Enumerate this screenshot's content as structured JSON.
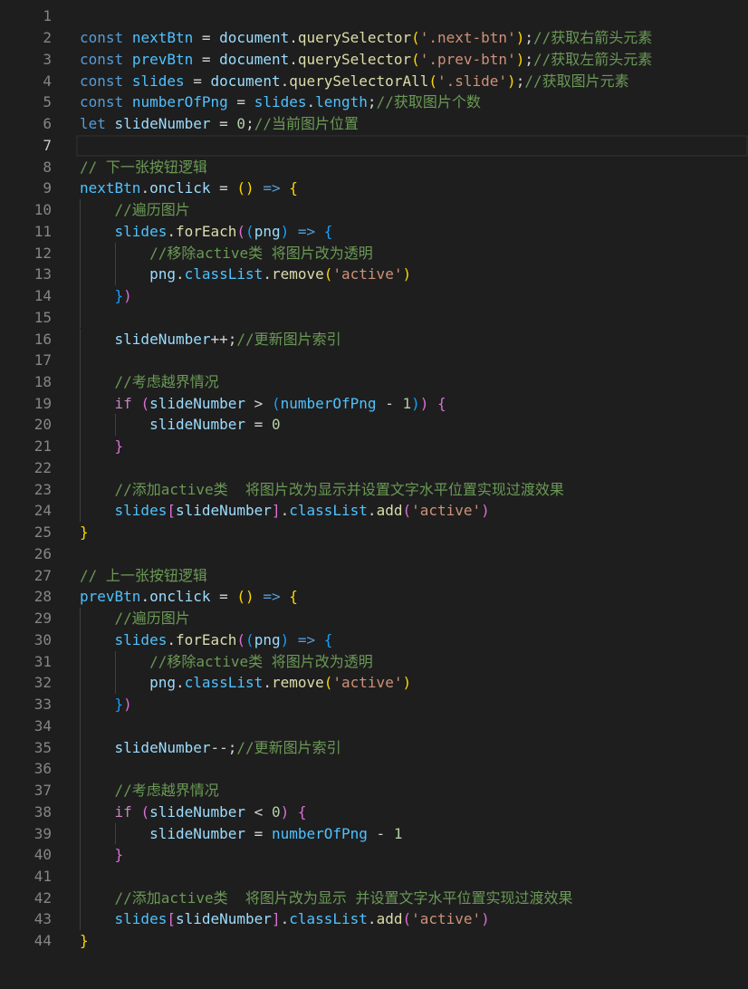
{
  "editor": {
    "active_line": 7,
    "colors": {
      "background": "#1e1e1e",
      "line_number": "#858585",
      "line_number_active": "#c6c6c6",
      "indent_guide": "#404040"
    },
    "lines": [
      {
        "n": "1",
        "tokens": []
      },
      {
        "n": "2",
        "tokens": [
          {
            "t": "const",
            "c": "#569cd6"
          },
          {
            "t": " ",
            "c": "#d4d4d4"
          },
          {
            "t": "nextBtn",
            "c": "#4fc1ff"
          },
          {
            "t": " = ",
            "c": "#d4d4d4"
          },
          {
            "t": "document",
            "c": "#9cdcfe"
          },
          {
            "t": ".",
            "c": "#d4d4d4"
          },
          {
            "t": "querySelector",
            "c": "#dcdcaa"
          },
          {
            "t": "(",
            "c": "#ffd700"
          },
          {
            "t": "'.next-btn'",
            "c": "#ce9178"
          },
          {
            "t": ")",
            "c": "#ffd700"
          },
          {
            "t": ";",
            "c": "#d4d4d4"
          },
          {
            "t": "//获取右箭头元素",
            "c": "#6a9955"
          }
        ]
      },
      {
        "n": "3",
        "tokens": [
          {
            "t": "const",
            "c": "#569cd6"
          },
          {
            "t": " ",
            "c": "#d4d4d4"
          },
          {
            "t": "prevBtn",
            "c": "#4fc1ff"
          },
          {
            "t": " = ",
            "c": "#d4d4d4"
          },
          {
            "t": "document",
            "c": "#9cdcfe"
          },
          {
            "t": ".",
            "c": "#d4d4d4"
          },
          {
            "t": "querySelector",
            "c": "#dcdcaa"
          },
          {
            "t": "(",
            "c": "#ffd700"
          },
          {
            "t": "'.prev-btn'",
            "c": "#ce9178"
          },
          {
            "t": ")",
            "c": "#ffd700"
          },
          {
            "t": ";",
            "c": "#d4d4d4"
          },
          {
            "t": "//获取左箭头元素",
            "c": "#6a9955"
          }
        ]
      },
      {
        "n": "4",
        "tokens": [
          {
            "t": "const",
            "c": "#569cd6"
          },
          {
            "t": " ",
            "c": "#d4d4d4"
          },
          {
            "t": "slides",
            "c": "#4fc1ff"
          },
          {
            "t": " = ",
            "c": "#d4d4d4"
          },
          {
            "t": "document",
            "c": "#9cdcfe"
          },
          {
            "t": ".",
            "c": "#d4d4d4"
          },
          {
            "t": "querySelectorAll",
            "c": "#dcdcaa"
          },
          {
            "t": "(",
            "c": "#ffd700"
          },
          {
            "t": "'.slide'",
            "c": "#ce9178"
          },
          {
            "t": ")",
            "c": "#ffd700"
          },
          {
            "t": ";",
            "c": "#d4d4d4"
          },
          {
            "t": "//获取图片元素",
            "c": "#6a9955"
          }
        ]
      },
      {
        "n": "5",
        "tokens": [
          {
            "t": "const",
            "c": "#569cd6"
          },
          {
            "t": " ",
            "c": "#d4d4d4"
          },
          {
            "t": "numberOfPng",
            "c": "#4fc1ff"
          },
          {
            "t": " = ",
            "c": "#d4d4d4"
          },
          {
            "t": "slides",
            "c": "#4fc1ff"
          },
          {
            "t": ".",
            "c": "#d4d4d4"
          },
          {
            "t": "length",
            "c": "#4fc1ff"
          },
          {
            "t": ";",
            "c": "#d4d4d4"
          },
          {
            "t": "//获取图片个数",
            "c": "#6a9955"
          }
        ]
      },
      {
        "n": "6",
        "tokens": [
          {
            "t": "let",
            "c": "#569cd6"
          },
          {
            "t": " ",
            "c": "#d4d4d4"
          },
          {
            "t": "slideNumber",
            "c": "#9cdcfe"
          },
          {
            "t": " = ",
            "c": "#d4d4d4"
          },
          {
            "t": "0",
            "c": "#b5cea8"
          },
          {
            "t": ";",
            "c": "#d4d4d4"
          },
          {
            "t": "//当前图片位置",
            "c": "#6a9955"
          }
        ]
      },
      {
        "n": "7",
        "tokens": []
      },
      {
        "n": "8",
        "tokens": [
          {
            "t": "// 下一张按钮逻辑",
            "c": "#6a9955"
          }
        ]
      },
      {
        "n": "9",
        "tokens": [
          {
            "t": "nextBtn",
            "c": "#4fc1ff"
          },
          {
            "t": ".",
            "c": "#d4d4d4"
          },
          {
            "t": "onclick",
            "c": "#9cdcfe"
          },
          {
            "t": " = ",
            "c": "#d4d4d4"
          },
          {
            "t": "()",
            "c": "#ffd700"
          },
          {
            "t": " ",
            "c": "#d4d4d4"
          },
          {
            "t": "=>",
            "c": "#569cd6"
          },
          {
            "t": " ",
            "c": "#d4d4d4"
          },
          {
            "t": "{",
            "c": "#ffd700"
          }
        ]
      },
      {
        "n": "10",
        "tokens": [
          {
            "t": "    ",
            "c": "#d4d4d4"
          },
          {
            "t": "//遍历图片",
            "c": "#6a9955"
          }
        ]
      },
      {
        "n": "11",
        "tokens": [
          {
            "t": "    ",
            "c": "#d4d4d4"
          },
          {
            "t": "slides",
            "c": "#4fc1ff"
          },
          {
            "t": ".",
            "c": "#d4d4d4"
          },
          {
            "t": "forEach",
            "c": "#dcdcaa"
          },
          {
            "t": "(",
            "c": "#da70d6"
          },
          {
            "t": "(",
            "c": "#179fff"
          },
          {
            "t": "png",
            "c": "#9cdcfe"
          },
          {
            "t": ")",
            "c": "#179fff"
          },
          {
            "t": " ",
            "c": "#d4d4d4"
          },
          {
            "t": "=>",
            "c": "#569cd6"
          },
          {
            "t": " ",
            "c": "#d4d4d4"
          },
          {
            "t": "{",
            "c": "#179fff"
          }
        ]
      },
      {
        "n": "12",
        "tokens": [
          {
            "t": "        ",
            "c": "#d4d4d4"
          },
          {
            "t": "//移除active类 将图片改为透明",
            "c": "#6a9955"
          }
        ]
      },
      {
        "n": "13",
        "tokens": [
          {
            "t": "        ",
            "c": "#d4d4d4"
          },
          {
            "t": "png",
            "c": "#9cdcfe"
          },
          {
            "t": ".",
            "c": "#d4d4d4"
          },
          {
            "t": "classList",
            "c": "#4fc1ff"
          },
          {
            "t": ".",
            "c": "#d4d4d4"
          },
          {
            "t": "remove",
            "c": "#dcdcaa"
          },
          {
            "t": "(",
            "c": "#ffd700"
          },
          {
            "t": "'active'",
            "c": "#ce9178"
          },
          {
            "t": ")",
            "c": "#ffd700"
          }
        ]
      },
      {
        "n": "14",
        "tokens": [
          {
            "t": "    ",
            "c": "#d4d4d4"
          },
          {
            "t": "}",
            "c": "#179fff"
          },
          {
            "t": ")",
            "c": "#da70d6"
          }
        ]
      },
      {
        "n": "15",
        "tokens": []
      },
      {
        "n": "16",
        "tokens": [
          {
            "t": "    ",
            "c": "#d4d4d4"
          },
          {
            "t": "slideNumber",
            "c": "#9cdcfe"
          },
          {
            "t": "++;",
            "c": "#d4d4d4"
          },
          {
            "t": "//更新图片索引",
            "c": "#6a9955"
          }
        ]
      },
      {
        "n": "17",
        "tokens": []
      },
      {
        "n": "18",
        "tokens": [
          {
            "t": "    ",
            "c": "#d4d4d4"
          },
          {
            "t": "//考虑越界情况",
            "c": "#6a9955"
          }
        ]
      },
      {
        "n": "19",
        "tokens": [
          {
            "t": "    ",
            "c": "#d4d4d4"
          },
          {
            "t": "if",
            "c": "#c586c0"
          },
          {
            "t": " ",
            "c": "#d4d4d4"
          },
          {
            "t": "(",
            "c": "#da70d6"
          },
          {
            "t": "slideNumber",
            "c": "#9cdcfe"
          },
          {
            "t": " > ",
            "c": "#d4d4d4"
          },
          {
            "t": "(",
            "c": "#179fff"
          },
          {
            "t": "numberOfPng",
            "c": "#4fc1ff"
          },
          {
            "t": " - ",
            "c": "#d4d4d4"
          },
          {
            "t": "1",
            "c": "#b5cea8"
          },
          {
            "t": ")",
            "c": "#179fff"
          },
          {
            "t": ")",
            "c": "#da70d6"
          },
          {
            "t": " ",
            "c": "#d4d4d4"
          },
          {
            "t": "{",
            "c": "#da70d6"
          }
        ]
      },
      {
        "n": "20",
        "tokens": [
          {
            "t": "        ",
            "c": "#d4d4d4"
          },
          {
            "t": "slideNumber",
            "c": "#9cdcfe"
          },
          {
            "t": " = ",
            "c": "#d4d4d4"
          },
          {
            "t": "0",
            "c": "#b5cea8"
          }
        ]
      },
      {
        "n": "21",
        "tokens": [
          {
            "t": "    ",
            "c": "#d4d4d4"
          },
          {
            "t": "}",
            "c": "#da70d6"
          }
        ]
      },
      {
        "n": "22",
        "tokens": []
      },
      {
        "n": "23",
        "tokens": [
          {
            "t": "    ",
            "c": "#d4d4d4"
          },
          {
            "t": "//添加active类  将图片改为显示并设置文字水平位置实现过渡效果",
            "c": "#6a9955"
          }
        ]
      },
      {
        "n": "24",
        "tokens": [
          {
            "t": "    ",
            "c": "#d4d4d4"
          },
          {
            "t": "slides",
            "c": "#4fc1ff"
          },
          {
            "t": "[",
            "c": "#da70d6"
          },
          {
            "t": "slideNumber",
            "c": "#9cdcfe"
          },
          {
            "t": "]",
            "c": "#da70d6"
          },
          {
            "t": ".",
            "c": "#d4d4d4"
          },
          {
            "t": "classList",
            "c": "#4fc1ff"
          },
          {
            "t": ".",
            "c": "#d4d4d4"
          },
          {
            "t": "add",
            "c": "#dcdcaa"
          },
          {
            "t": "(",
            "c": "#da70d6"
          },
          {
            "t": "'active'",
            "c": "#ce9178"
          },
          {
            "t": ")",
            "c": "#da70d6"
          }
        ]
      },
      {
        "n": "25",
        "tokens": [
          {
            "t": "}",
            "c": "#ffd700"
          }
        ]
      },
      {
        "n": "26",
        "tokens": []
      },
      {
        "n": "27",
        "tokens": [
          {
            "t": "// 上一张按钮逻辑",
            "c": "#6a9955"
          }
        ]
      },
      {
        "n": "28",
        "tokens": [
          {
            "t": "prevBtn",
            "c": "#4fc1ff"
          },
          {
            "t": ".",
            "c": "#d4d4d4"
          },
          {
            "t": "onclick",
            "c": "#9cdcfe"
          },
          {
            "t": " = ",
            "c": "#d4d4d4"
          },
          {
            "t": "()",
            "c": "#ffd700"
          },
          {
            "t": " ",
            "c": "#d4d4d4"
          },
          {
            "t": "=>",
            "c": "#569cd6"
          },
          {
            "t": " ",
            "c": "#d4d4d4"
          },
          {
            "t": "{",
            "c": "#ffd700"
          }
        ]
      },
      {
        "n": "29",
        "tokens": [
          {
            "t": "    ",
            "c": "#d4d4d4"
          },
          {
            "t": "//遍历图片",
            "c": "#6a9955"
          }
        ]
      },
      {
        "n": "30",
        "tokens": [
          {
            "t": "    ",
            "c": "#d4d4d4"
          },
          {
            "t": "slides",
            "c": "#4fc1ff"
          },
          {
            "t": ".",
            "c": "#d4d4d4"
          },
          {
            "t": "forEach",
            "c": "#dcdcaa"
          },
          {
            "t": "(",
            "c": "#da70d6"
          },
          {
            "t": "(",
            "c": "#179fff"
          },
          {
            "t": "png",
            "c": "#9cdcfe"
          },
          {
            "t": ")",
            "c": "#179fff"
          },
          {
            "t": " ",
            "c": "#d4d4d4"
          },
          {
            "t": "=>",
            "c": "#569cd6"
          },
          {
            "t": " ",
            "c": "#d4d4d4"
          },
          {
            "t": "{",
            "c": "#179fff"
          }
        ]
      },
      {
        "n": "31",
        "tokens": [
          {
            "t": "        ",
            "c": "#d4d4d4"
          },
          {
            "t": "//移除active类 将图片改为透明",
            "c": "#6a9955"
          }
        ]
      },
      {
        "n": "32",
        "tokens": [
          {
            "t": "        ",
            "c": "#d4d4d4"
          },
          {
            "t": "png",
            "c": "#9cdcfe"
          },
          {
            "t": ".",
            "c": "#d4d4d4"
          },
          {
            "t": "classList",
            "c": "#4fc1ff"
          },
          {
            "t": ".",
            "c": "#d4d4d4"
          },
          {
            "t": "remove",
            "c": "#dcdcaa"
          },
          {
            "t": "(",
            "c": "#ffd700"
          },
          {
            "t": "'active'",
            "c": "#ce9178"
          },
          {
            "t": ")",
            "c": "#ffd700"
          }
        ]
      },
      {
        "n": "33",
        "tokens": [
          {
            "t": "    ",
            "c": "#d4d4d4"
          },
          {
            "t": "}",
            "c": "#179fff"
          },
          {
            "t": ")",
            "c": "#da70d6"
          }
        ]
      },
      {
        "n": "34",
        "tokens": []
      },
      {
        "n": "35",
        "tokens": [
          {
            "t": "    ",
            "c": "#d4d4d4"
          },
          {
            "t": "slideNumber",
            "c": "#9cdcfe"
          },
          {
            "t": "--;",
            "c": "#d4d4d4"
          },
          {
            "t": "//更新图片索引",
            "c": "#6a9955"
          }
        ]
      },
      {
        "n": "36",
        "tokens": []
      },
      {
        "n": "37",
        "tokens": [
          {
            "t": "    ",
            "c": "#d4d4d4"
          },
          {
            "t": "//考虑越界情况",
            "c": "#6a9955"
          }
        ]
      },
      {
        "n": "38",
        "tokens": [
          {
            "t": "    ",
            "c": "#d4d4d4"
          },
          {
            "t": "if",
            "c": "#c586c0"
          },
          {
            "t": " ",
            "c": "#d4d4d4"
          },
          {
            "t": "(",
            "c": "#da70d6"
          },
          {
            "t": "slideNumber",
            "c": "#9cdcfe"
          },
          {
            "t": " < ",
            "c": "#d4d4d4"
          },
          {
            "t": "0",
            "c": "#b5cea8"
          },
          {
            "t": ")",
            "c": "#da70d6"
          },
          {
            "t": " ",
            "c": "#d4d4d4"
          },
          {
            "t": "{",
            "c": "#da70d6"
          }
        ]
      },
      {
        "n": "39",
        "tokens": [
          {
            "t": "        ",
            "c": "#d4d4d4"
          },
          {
            "t": "slideNumber",
            "c": "#9cdcfe"
          },
          {
            "t": " = ",
            "c": "#d4d4d4"
          },
          {
            "t": "numberOfPng",
            "c": "#4fc1ff"
          },
          {
            "t": " - ",
            "c": "#d4d4d4"
          },
          {
            "t": "1",
            "c": "#b5cea8"
          }
        ]
      },
      {
        "n": "40",
        "tokens": [
          {
            "t": "    ",
            "c": "#d4d4d4"
          },
          {
            "t": "}",
            "c": "#da70d6"
          }
        ]
      },
      {
        "n": "41",
        "tokens": []
      },
      {
        "n": "42",
        "tokens": [
          {
            "t": "    ",
            "c": "#d4d4d4"
          },
          {
            "t": "//添加active类  将图片改为显示 并设置文字水平位置实现过渡效果",
            "c": "#6a9955"
          }
        ]
      },
      {
        "n": "43",
        "tokens": [
          {
            "t": "    ",
            "c": "#d4d4d4"
          },
          {
            "t": "slides",
            "c": "#4fc1ff"
          },
          {
            "t": "[",
            "c": "#da70d6"
          },
          {
            "t": "slideNumber",
            "c": "#9cdcfe"
          },
          {
            "t": "]",
            "c": "#da70d6"
          },
          {
            "t": ".",
            "c": "#d4d4d4"
          },
          {
            "t": "classList",
            "c": "#4fc1ff"
          },
          {
            "t": ".",
            "c": "#d4d4d4"
          },
          {
            "t": "add",
            "c": "#dcdcaa"
          },
          {
            "t": "(",
            "c": "#da70d6"
          },
          {
            "t": "'active'",
            "c": "#ce9178"
          },
          {
            "t": ")",
            "c": "#da70d6"
          }
        ]
      },
      {
        "n": "44",
        "tokens": [
          {
            "t": "}",
            "c": "#ffd700"
          }
        ]
      }
    ]
  }
}
